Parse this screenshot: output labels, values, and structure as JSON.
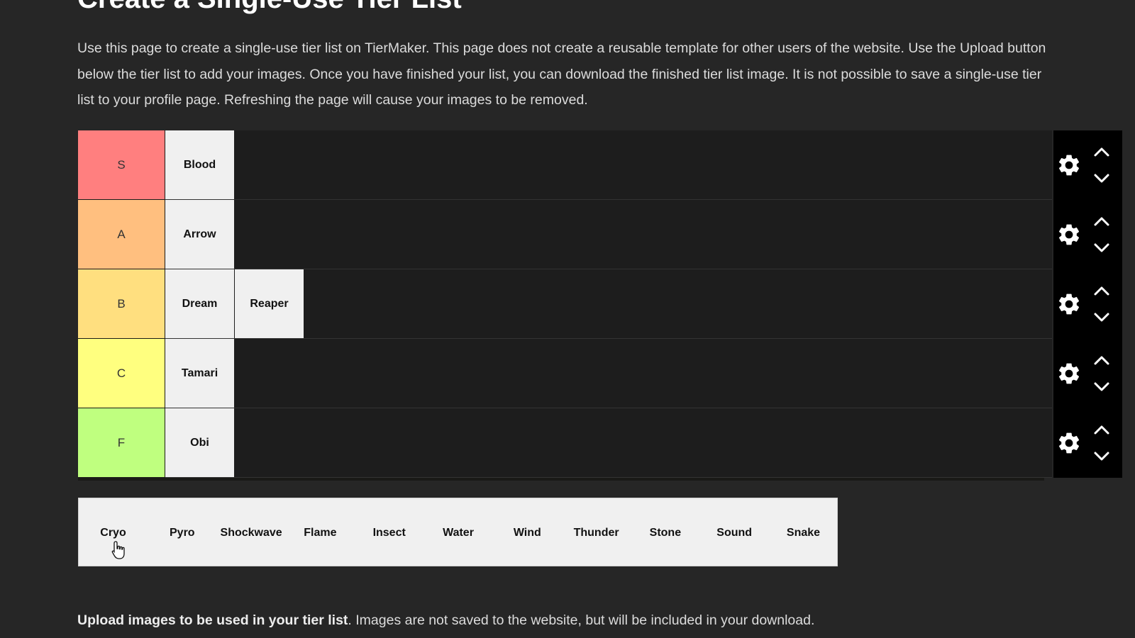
{
  "page": {
    "title": "Create a Single-Use Tier List",
    "intro": "Use this page to create a single-use tier list on TierMaker. This page does not create a reusable template for other users of the website. Use the Upload button below the tier list to add your images. Once you have finished your list, you can download the finished tier list image. It is not possible to save a single-use tier list to your profile page. Refreshing the page will cause your images to be removed."
  },
  "tiers": [
    {
      "label": "S",
      "color": "#ff7f7f",
      "items": [
        "Blood"
      ]
    },
    {
      "label": "A",
      "color": "#ffbf7f",
      "items": [
        "Arrow"
      ]
    },
    {
      "label": "B",
      "color": "#ffdf7f",
      "items": [
        "Dream",
        "Reaper"
      ]
    },
    {
      "label": "C",
      "color": "#ffff7f",
      "items": [
        "Tamari"
      ]
    },
    {
      "label": "F",
      "color": "#bfff7f",
      "items": [
        "Obi"
      ]
    }
  ],
  "controls": {
    "settings_icon": "gear-icon",
    "move_up_icon": "chevron-up-icon",
    "move_down_icon": "chevron-down-icon"
  },
  "pool": {
    "items": [
      "Cryo",
      "Pyro",
      "Shockwave",
      "Flame",
      "Insect",
      "Water",
      "Wind",
      "Thunder",
      "Stone",
      "Sound",
      "Snake"
    ]
  },
  "upload": {
    "bold_text": "Upload images to be used in your tier list",
    "rest_text": ". Images are not saved to the website, but will be included in your download."
  },
  "colors": {
    "background": "#262626",
    "controls_background": "#000000",
    "item_background": "#f0f0f0"
  }
}
